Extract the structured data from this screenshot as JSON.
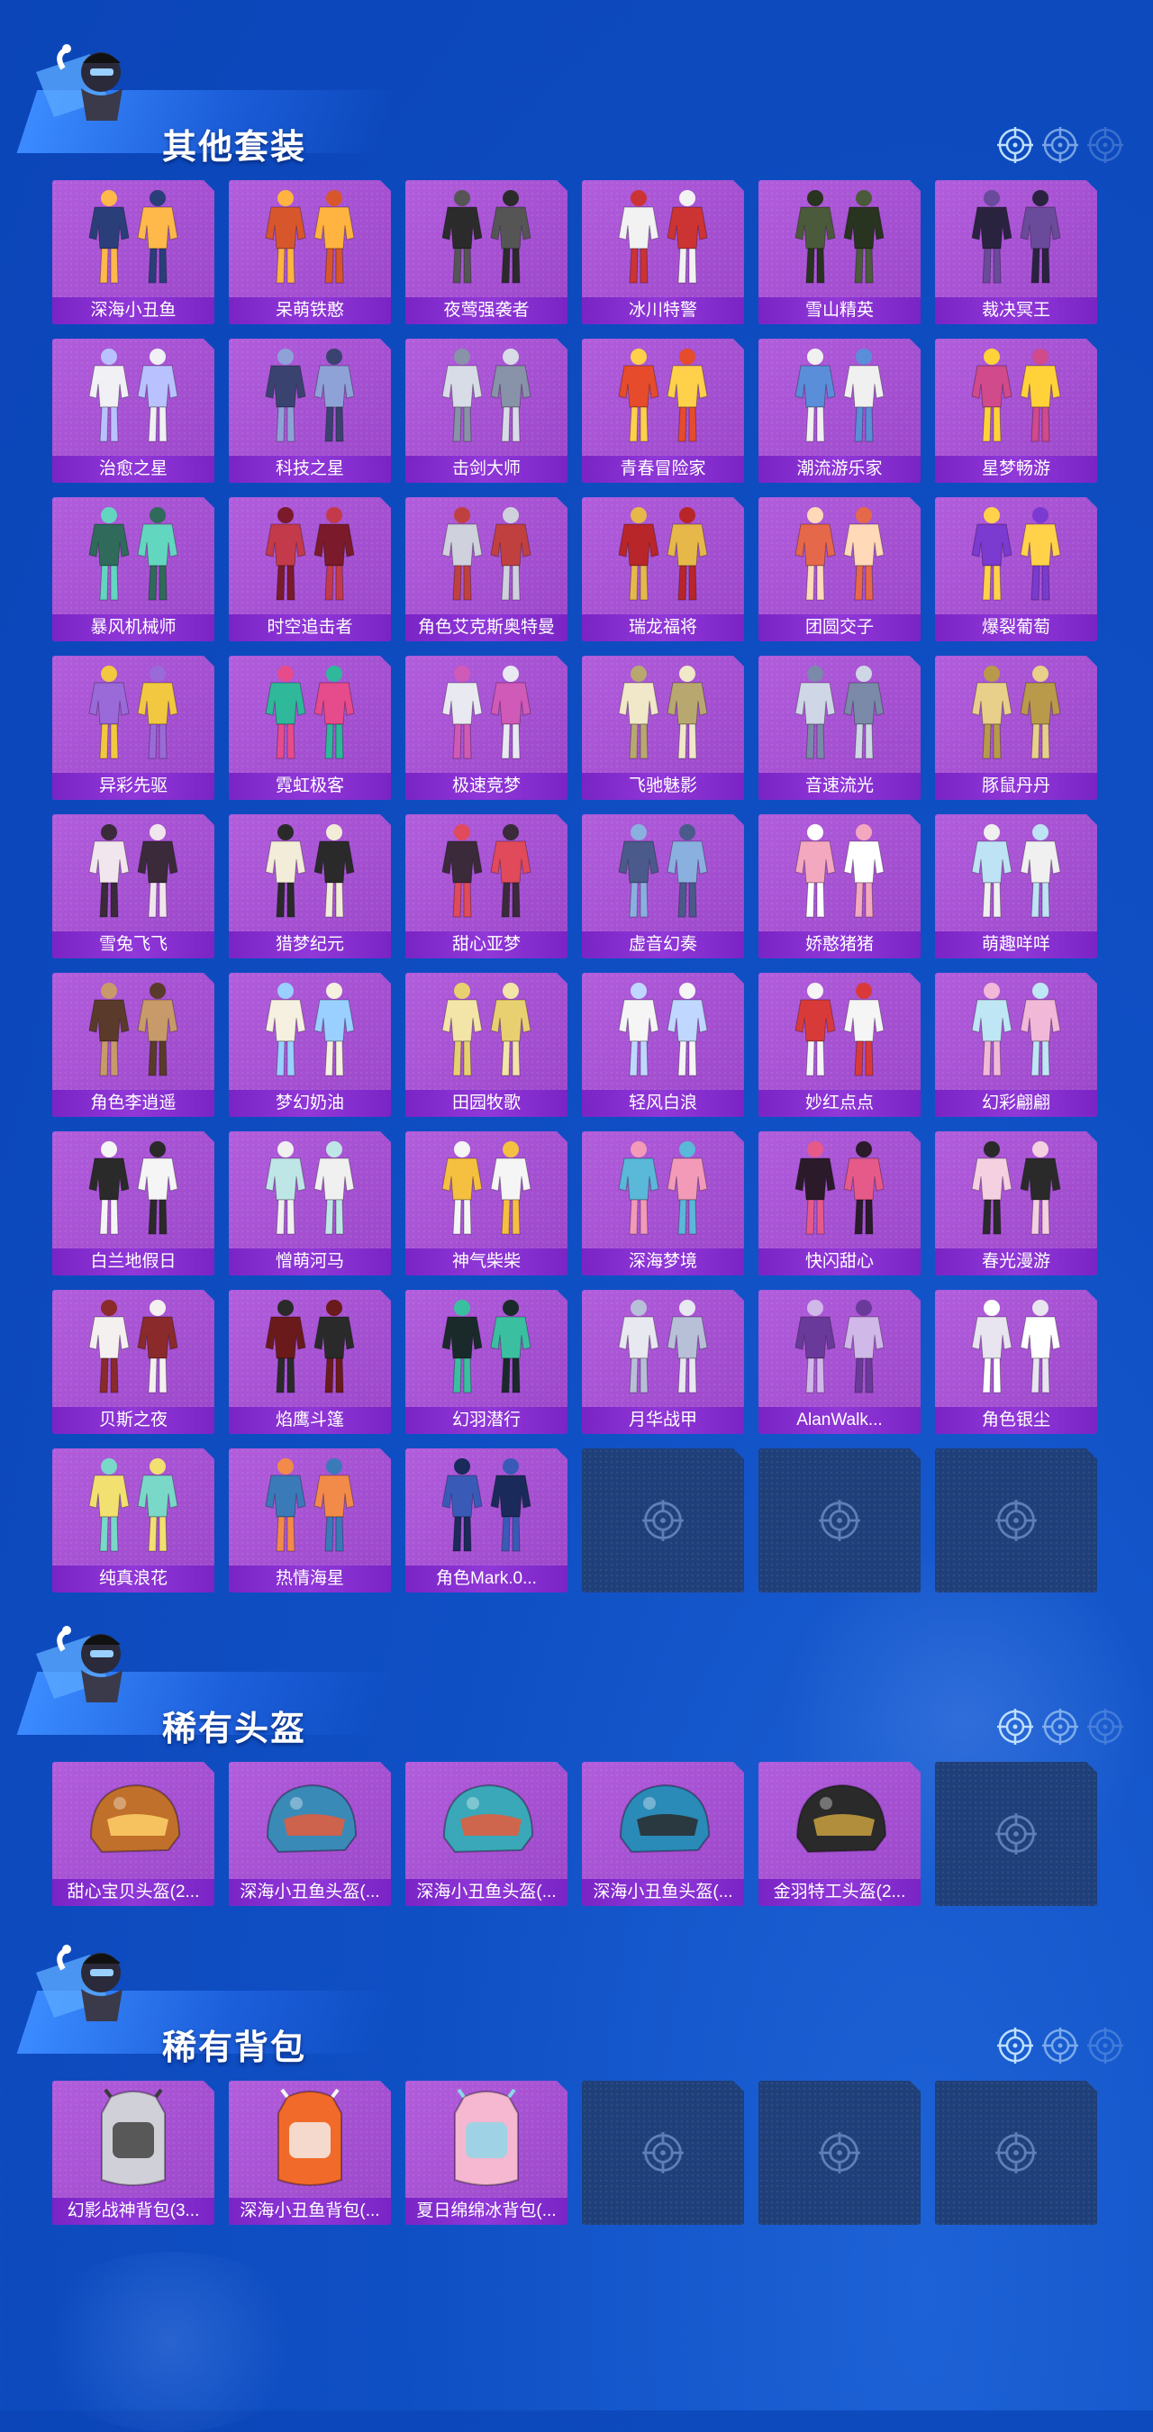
{
  "sections": [
    {
      "title": "其他套装",
      "items": [
        "深海小丑鱼",
        "呆萌铁憨",
        "夜莺强袭者",
        "冰川特警",
        "雪山精英",
        "裁决冥王",
        "治愈之星",
        "科技之星",
        "击剑大师",
        "青春冒险家",
        "潮流游乐家",
        "星梦畅游",
        "暴风机械师",
        "时空追击者",
        "角色艾克斯奥特曼",
        "瑞龙福将",
        "团圆交子",
        "爆裂葡萄",
        "异彩先驱",
        "霓虹极客",
        "极速竞梦",
        "飞驰魅影",
        "音速流光",
        "豚鼠丹丹",
        "雪兔飞飞",
        "猎梦纪元",
        "甜心亚梦",
        "虚音幻奏",
        "娇憨猪猪",
        "萌趣咩咩",
        "角色李逍遥",
        "梦幻奶油",
        "田园牧歌",
        "轻风白浪",
        "妙红点点",
        "幻彩翩翩",
        "白兰地假日",
        "憎萌河马",
        "神气柴柴",
        "深海梦境",
        "快闪甜心",
        "春光漫游",
        "贝斯之夜",
        "焰鹰斗篷",
        "幻羽潜行",
        "月华战甲",
        "AlanWalk...",
        "角色银尘",
        "纯真浪花",
        "热情海星",
        "角色Mark.0..."
      ],
      "empty_slots": 3
    },
    {
      "title": "稀有头盔",
      "items": [
        "甜心宝贝头盔(2...",
        "深海小丑鱼头盔(...",
        "深海小丑鱼头盔(...",
        "深海小丑鱼头盔(...",
        "金羽特工头盔(2..."
      ],
      "empty_slots": 1
    },
    {
      "title": "稀有背包",
      "items": [
        "幻影战神背包(3...",
        "深海小丑鱼背包(...",
        "夏日绵绵冰背包(..."
      ],
      "empty_slots": 3
    }
  ]
}
